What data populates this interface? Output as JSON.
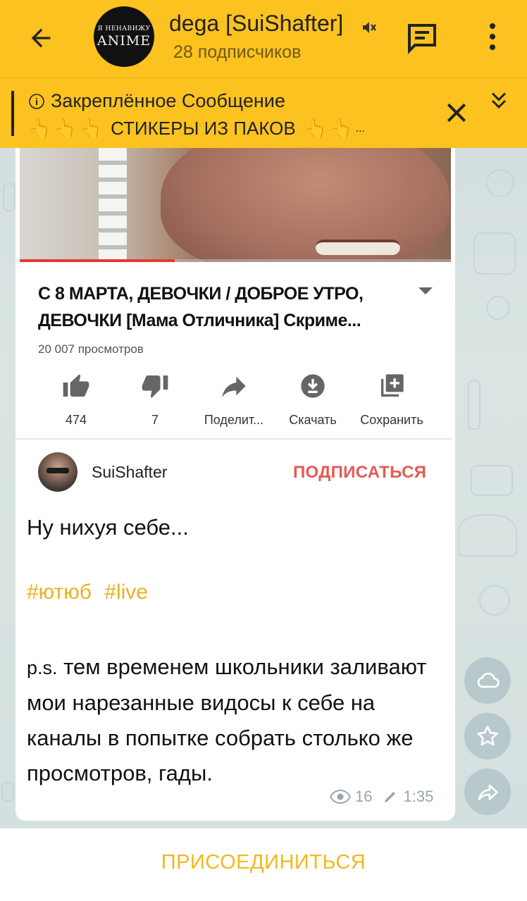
{
  "header": {
    "avatar_text_line1": "Я НЕНАВИЖУ",
    "avatar_text_line2": "ANIME",
    "title": "dega [SuiShafter]",
    "subtitle": "28 подписчиков"
  },
  "pinned": {
    "title": "Закреплённое Сообщение",
    "text": "СТИКЕРЫ ИЗ ПАКОВ",
    "ellipsis": "...",
    "hand_emoji": "👆"
  },
  "youtube": {
    "title_line1": "С 8 МАРТА, ДЕВОЧКИ / ДОБРОЕ УТРО,",
    "title_line2": "ДЕВОЧКИ [Мама Отличника] Скриме...",
    "views": "20 007 просмотров",
    "progress_fraction": 0.36,
    "actions": [
      {
        "label": "474",
        "icon": "thumb-up-icon"
      },
      {
        "label": "7",
        "icon": "thumb-down-icon"
      },
      {
        "label": "Поделит...",
        "icon": "share-icon"
      },
      {
        "label": "Скачать",
        "icon": "download-icon"
      },
      {
        "label": "Сохранить",
        "icon": "playlist-add-icon"
      }
    ],
    "channel_name": "SuiShafter",
    "subscribe_label": "ПОДПИСАТЬСЯ"
  },
  "message": {
    "line1": "Ну нихуя себе...",
    "tags": [
      "#ютюб",
      "#live"
    ],
    "ps_prefix": "p.s.",
    "ps_text": "тем временем школьники заливают мои нарезанные видосы к себе на каналы в попытке собрать столько же просмотров, гады.",
    "views": "16",
    "time": "1:35"
  },
  "bottom": {
    "join_label": "ПРИСОЕДИНИТЬСЯ"
  },
  "colors": {
    "accent": "#fcc21f",
    "subscribe": "#e55a55",
    "tag": "#e8b21f",
    "join": "#f0b91c"
  }
}
